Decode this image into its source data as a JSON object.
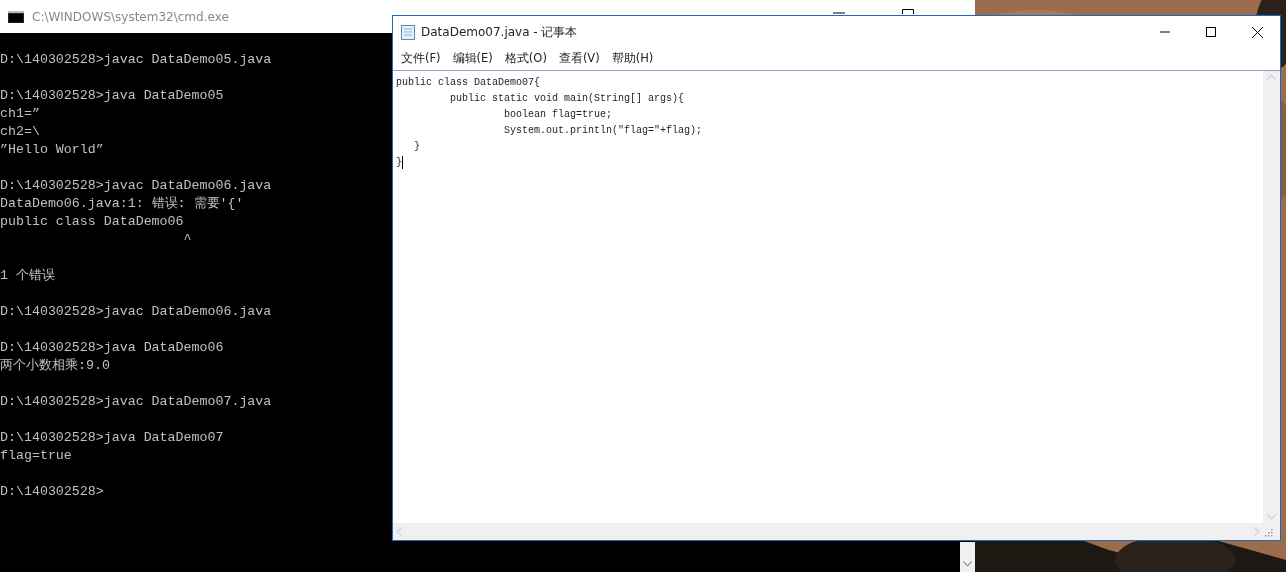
{
  "console_window": {
    "title": "C:\\WINDOWS\\system32\\cmd.exe",
    "blocks": [
      [
        "D:\\140302528>javac DataDemo05.java"
      ],
      [
        "D:\\140302528>java DataDemo05",
        "ch1=”",
        "ch2=\\",
        "”Hello World”"
      ],
      [
        "D:\\140302528>javac DataDemo06.java",
        "DataDemo06.java:1: 错误: 需要'{'",
        "public class DataDemo06",
        "                       ^"
      ],
      [
        "1 个错误"
      ],
      [
        "D:\\140302528>javac DataDemo06.java"
      ],
      [
        "D:\\140302528>java DataDemo06",
        "两个小数相乘:9.0"
      ],
      [
        "D:\\140302528>javac DataDemo07.java"
      ],
      [
        "D:\\140302528>java DataDemo07",
        "flag=true"
      ],
      [
        "D:\\140302528>"
      ]
    ]
  },
  "notepad_window": {
    "title": "DataDemo07.java - 记事本",
    "menu": [
      "文件(F)",
      "编辑(E)",
      "格式(O)",
      "查看(V)",
      "帮助(H)"
    ],
    "code_lines": [
      "public class DataDemo07{",
      "\tpublic static void main(String[] args){",
      "\t\tboolean flag=true;",
      "\t\tSystem.out.println(\"flag=\"+flag);",
      "   }",
      "}"
    ]
  }
}
